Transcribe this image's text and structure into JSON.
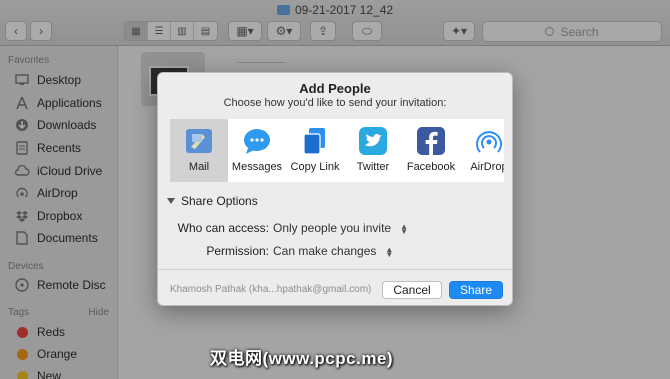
{
  "window": {
    "title": "09-21-2017 12_42"
  },
  "toolbar": {
    "search_placeholder": "Search"
  },
  "sidebar": {
    "favorites_heading": "Favorites",
    "favorites": [
      {
        "label": "Desktop",
        "icon": "desktop-icon"
      },
      {
        "label": "Applications",
        "icon": "applications-icon"
      },
      {
        "label": "Downloads",
        "icon": "downloads-icon"
      },
      {
        "label": "Recents",
        "icon": "recents-icon"
      },
      {
        "label": "iCloud Drive",
        "icon": "cloud-icon"
      },
      {
        "label": "AirDrop",
        "icon": "airdrop-icon"
      },
      {
        "label": "Dropbox",
        "icon": "dropbox-icon"
      },
      {
        "label": "Documents",
        "icon": "documents-icon"
      }
    ],
    "devices_heading": "Devices",
    "devices": [
      {
        "label": "Remote Disc",
        "icon": "disc-icon"
      }
    ],
    "tags_heading": "Tags",
    "tags_hide": "Hide",
    "tags": [
      {
        "label": "Reds",
        "color": "#e8453c"
      },
      {
        "label": "Orange",
        "color": "#f39a1e"
      },
      {
        "label": "New",
        "color": "#f3c61e"
      }
    ]
  },
  "dialog": {
    "title": "Add People",
    "subtitle": "Choose how you'd like to send your invitation:",
    "share_targets": [
      {
        "label": "Mail",
        "icon": "mail-icon",
        "selected": true
      },
      {
        "label": "Messages",
        "icon": "messages-icon"
      },
      {
        "label": "Copy Link",
        "icon": "copy-link-icon"
      },
      {
        "label": "Twitter",
        "icon": "twitter-icon"
      },
      {
        "label": "Facebook",
        "icon": "facebook-icon"
      },
      {
        "label": "AirDrop",
        "icon": "airdrop-icon"
      }
    ],
    "share_options_label": "Share Options",
    "who_can_access_label": "Who can access:",
    "who_can_access_value": "Only people you invite",
    "permission_label": "Permission:",
    "permission_value": "Can make changes",
    "account": "Khamosh Pathak (kha...hpathak@gmail.com)",
    "cancel_label": "Cancel",
    "share_label": "Share",
    "accent": "#1e8bf3"
  },
  "watermark": "双电网(www.pcpc.me)"
}
